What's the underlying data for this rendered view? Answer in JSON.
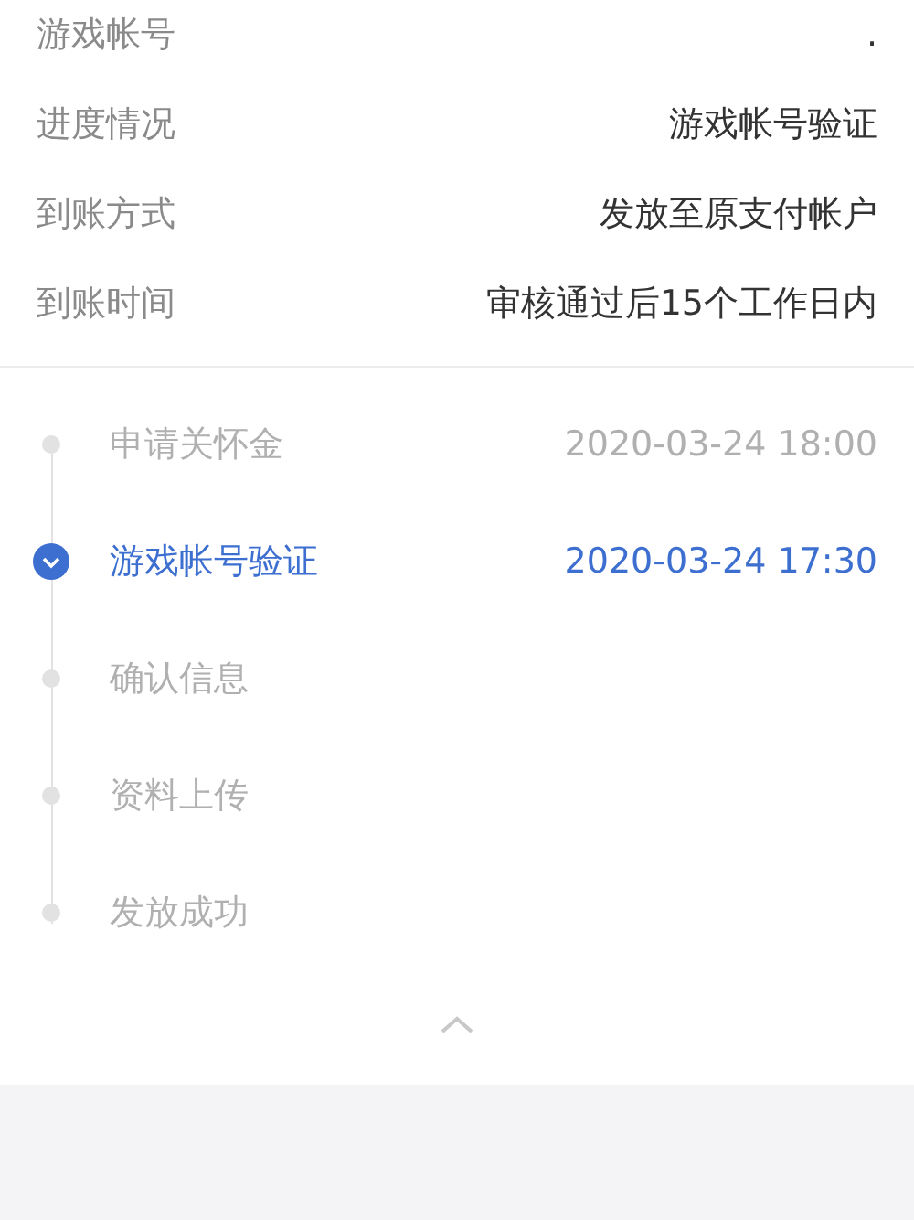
{
  "details": [
    {
      "label": "游戏帐号",
      "value": "."
    },
    {
      "label": "进度情况",
      "value": "游戏帐号验证"
    },
    {
      "label": "到账方式",
      "value": "发放至原支付帐户"
    },
    {
      "label": "到账时间",
      "value": "审核通过后15个工作日内"
    }
  ],
  "steps": [
    {
      "name": "申请关怀金",
      "time": "2020-03-24 18:00",
      "selected": false
    },
    {
      "name": "游戏帐号验证",
      "time": "2020-03-24 17:30",
      "selected": true
    },
    {
      "name": "确认信息",
      "selected": false
    },
    {
      "name": "资料上传",
      "selected": false
    },
    {
      "name": "发放成功",
      "selected": false
    }
  ]
}
